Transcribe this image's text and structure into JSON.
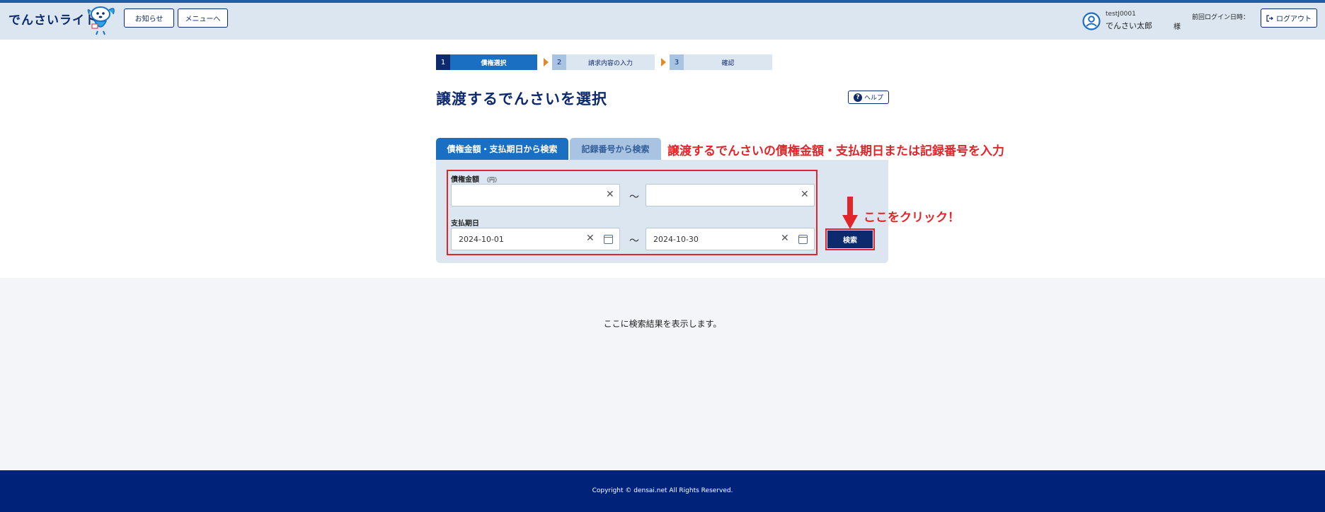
{
  "header": {
    "app_title": "でんさいライト",
    "news_button": "お知らせ",
    "menu_button": "メニューへ",
    "user_id": "testJ0001",
    "user_name": "でんさい太郎",
    "honorific": "様",
    "last_login_label": "前回ログイン日時：",
    "logout_button": "ログアウト"
  },
  "stepper": {
    "steps": [
      {
        "number": "1",
        "label": "債権選択",
        "state": "active"
      },
      {
        "number": "2",
        "label": "請求内容の入力",
        "state": "inactive"
      },
      {
        "number": "3",
        "label": "確認",
        "state": "inactive"
      }
    ]
  },
  "page": {
    "title": "譲渡するでんさいを選択",
    "help_button": "ヘルプ"
  },
  "tabs": {
    "items": [
      {
        "label": "債権金額・支払期日から検索",
        "active": true
      },
      {
        "label": "記録番号から検索",
        "active": false
      }
    ]
  },
  "annotations": {
    "instruction": "譲渡するでんさいの債権金額・支払期日または記録番号を入力",
    "click_here": "ここをクリック！",
    "color": "#e0262b"
  },
  "form": {
    "amount_label": "債権金額",
    "amount_unit": "（円）",
    "amount_from": "",
    "amount_to": "",
    "date_label": "支払期日",
    "date_from": "2024-10-01",
    "date_to": "2024-10-30",
    "range_separator": "〜",
    "search_button": "検索"
  },
  "results": {
    "placeholder": "ここに検索結果を表示します。"
  },
  "footer": {
    "copyright": "Copyright © densai.net All Rights Reserved."
  },
  "colors": {
    "brand_navy": "#0d2a6e",
    "accent_blue": "#1b6fc3",
    "header_bg": "#dbe6f1",
    "footer_bg": "#00237a"
  }
}
